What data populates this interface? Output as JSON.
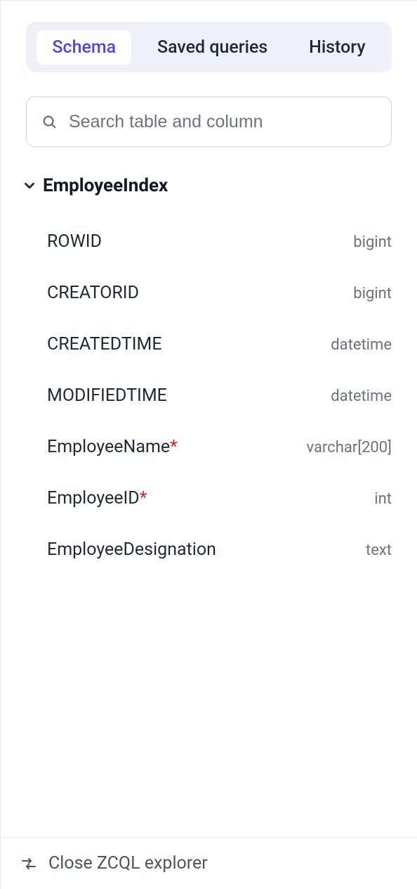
{
  "tabs": {
    "schema": "Schema",
    "saved_queries": "Saved queries",
    "history": "History"
  },
  "search": {
    "placeholder": "Search table and column"
  },
  "table": {
    "name": "EmployeeIndex",
    "columns": [
      {
        "name": "ROWID",
        "type": "bigint",
        "required": false
      },
      {
        "name": "CREATORID",
        "type": "bigint",
        "required": false
      },
      {
        "name": "CREATEDTIME",
        "type": "datetime",
        "required": false
      },
      {
        "name": "MODIFIEDTIME",
        "type": "datetime",
        "required": false
      },
      {
        "name": "EmployeeName",
        "type": "varchar[200]",
        "required": true
      },
      {
        "name": "EmployeeID",
        "type": "int",
        "required": true
      },
      {
        "name": "EmployeeDesignation",
        "type": "text",
        "required": false
      }
    ]
  },
  "footer": {
    "close_label": "Close ZCQL explorer"
  }
}
